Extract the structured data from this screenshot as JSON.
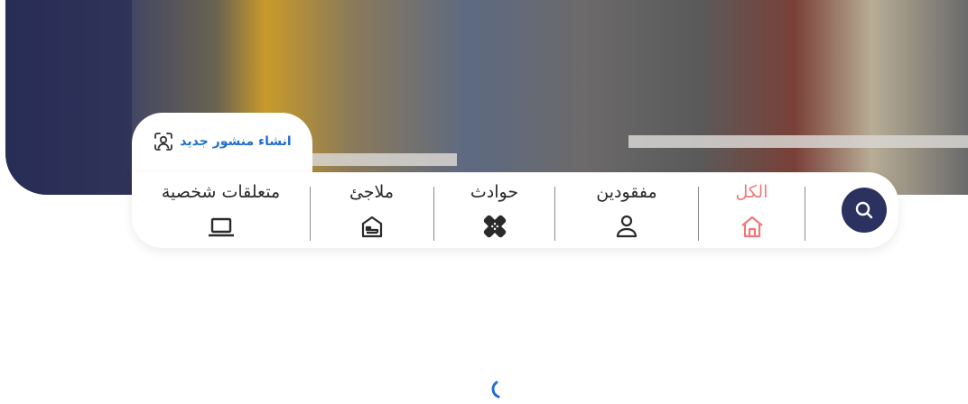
{
  "new_post": {
    "label": "انشاء منشور جديد",
    "icon": "user-scan-icon"
  },
  "tabs": [
    {
      "label": "الكل",
      "icon": "home-icon",
      "active": true
    },
    {
      "label": "مفقودين",
      "icon": "person-icon",
      "active": false
    },
    {
      "label": "حوادث",
      "icon": "bandage-icon",
      "active": false
    },
    {
      "label": "ملاجئ",
      "icon": "shelter-icon",
      "active": false
    },
    {
      "label": "متعلقات شخصية",
      "icon": "laptop-icon",
      "active": false
    }
  ],
  "search": {
    "icon": "search-icon"
  },
  "loading": {
    "icon": "loading-spinner-icon"
  },
  "colors": {
    "navy": "#2b3260",
    "active": "#ee7a7a",
    "link": "#1f6fd1"
  }
}
